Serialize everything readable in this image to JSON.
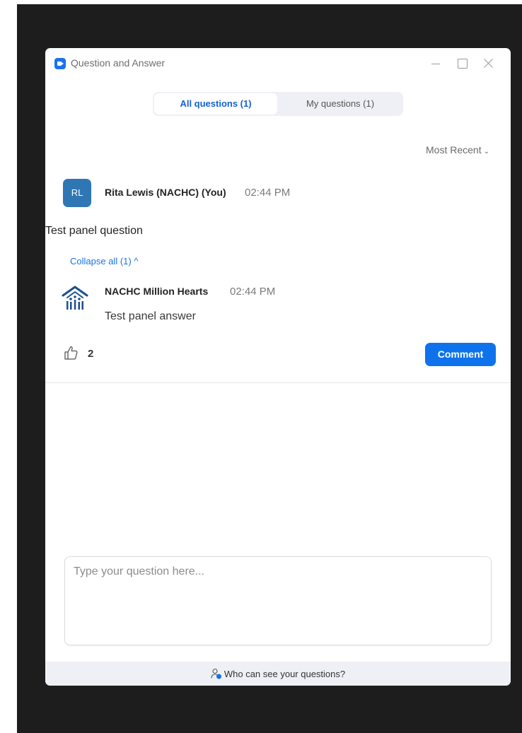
{
  "window": {
    "title": "Question and Answer",
    "app_icon": "zoom-icon",
    "controls": [
      "minimize-icon",
      "maximize-icon",
      "close-icon"
    ]
  },
  "tabs": [
    {
      "label": "All questions (1)",
      "selected": true
    },
    {
      "label": "My questions (1)",
      "selected": false
    }
  ],
  "sort": {
    "label": "Most Recent",
    "icon": "chevron-down-icon"
  },
  "question": {
    "avatar_initials": "RL",
    "author": "Rita Lewis (NACHC) (You)",
    "time": "02:44 PM",
    "text": "Test panel question",
    "collapse_label": "Collapse all (1) ^"
  },
  "answer": {
    "avatar_icon": "nachc-logo-icon",
    "author": "NACHC Million Hearts",
    "time": "02:44 PM",
    "text": "Test panel answer"
  },
  "actions": {
    "like_icon": "thumbs-up-icon",
    "like_count": "2",
    "comment_label": "Comment"
  },
  "composer": {
    "placeholder": "Type your question here..."
  },
  "footer": {
    "label": "Who can see your questions?",
    "icon": "person-info-icon"
  },
  "colors": {
    "accent": "#0e72ed",
    "avatar": "#2f76b5",
    "logo": "#1c4f8c"
  }
}
